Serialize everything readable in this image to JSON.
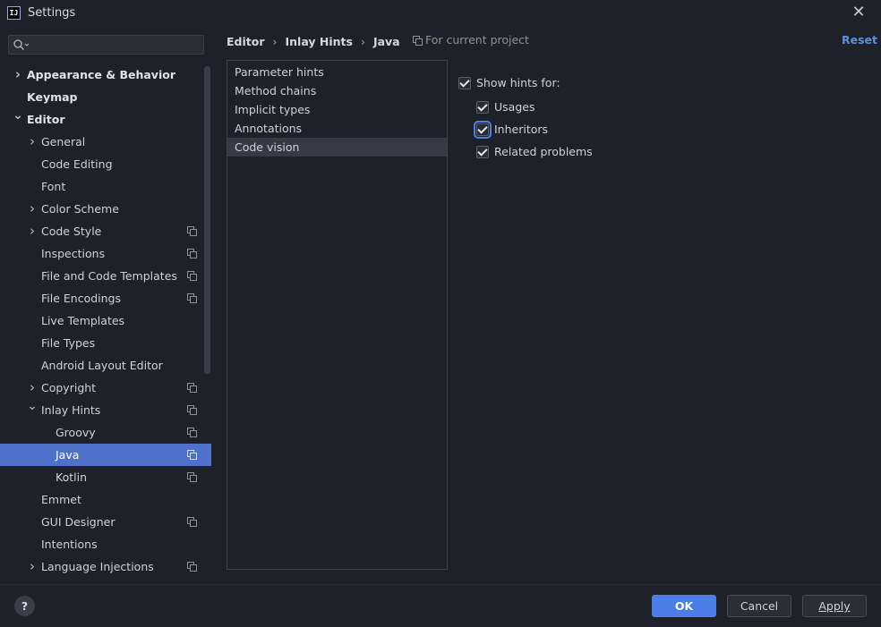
{
  "window": {
    "title": "Settings",
    "app_icon_text": "IJ"
  },
  "search": {
    "placeholder": ""
  },
  "tree": [
    {
      "label": "Appearance & Behavior",
      "level": 0,
      "bold": true,
      "expand": "collapsed",
      "copy": false,
      "selected": false
    },
    {
      "label": "Keymap",
      "level": 0,
      "bold": true,
      "expand": "none",
      "copy": false,
      "selected": false
    },
    {
      "label": "Editor",
      "level": 0,
      "bold": true,
      "expand": "expanded",
      "copy": false,
      "selected": false
    },
    {
      "label": "General",
      "level": 1,
      "bold": false,
      "expand": "collapsed",
      "copy": false,
      "selected": false
    },
    {
      "label": "Code Editing",
      "level": 1,
      "bold": false,
      "expand": "none",
      "copy": false,
      "selected": false
    },
    {
      "label": "Font",
      "level": 1,
      "bold": false,
      "expand": "none",
      "copy": false,
      "selected": false
    },
    {
      "label": "Color Scheme",
      "level": 1,
      "bold": false,
      "expand": "collapsed",
      "copy": false,
      "selected": false
    },
    {
      "label": "Code Style",
      "level": 1,
      "bold": false,
      "expand": "collapsed",
      "copy": true,
      "selected": false
    },
    {
      "label": "Inspections",
      "level": 1,
      "bold": false,
      "expand": "none",
      "copy": true,
      "selected": false
    },
    {
      "label": "File and Code Templates",
      "level": 1,
      "bold": false,
      "expand": "none",
      "copy": true,
      "selected": false
    },
    {
      "label": "File Encodings",
      "level": 1,
      "bold": false,
      "expand": "none",
      "copy": true,
      "selected": false
    },
    {
      "label": "Live Templates",
      "level": 1,
      "bold": false,
      "expand": "none",
      "copy": false,
      "selected": false
    },
    {
      "label": "File Types",
      "level": 1,
      "bold": false,
      "expand": "none",
      "copy": false,
      "selected": false
    },
    {
      "label": "Android Layout Editor",
      "level": 1,
      "bold": false,
      "expand": "none",
      "copy": false,
      "selected": false
    },
    {
      "label": "Copyright",
      "level": 1,
      "bold": false,
      "expand": "collapsed",
      "copy": true,
      "selected": false
    },
    {
      "label": "Inlay Hints",
      "level": 1,
      "bold": false,
      "expand": "expanded",
      "copy": true,
      "selected": false
    },
    {
      "label": "Groovy",
      "level": 2,
      "bold": false,
      "expand": "none",
      "copy": true,
      "selected": false
    },
    {
      "label": "Java",
      "level": 2,
      "bold": false,
      "expand": "none",
      "copy": true,
      "selected": true
    },
    {
      "label": "Kotlin",
      "level": 2,
      "bold": false,
      "expand": "none",
      "copy": true,
      "selected": false
    },
    {
      "label": "Emmet",
      "level": 1,
      "bold": false,
      "expand": "none",
      "copy": false,
      "selected": false
    },
    {
      "label": "GUI Designer",
      "level": 1,
      "bold": false,
      "expand": "none",
      "copy": true,
      "selected": false
    },
    {
      "label": "Intentions",
      "level": 1,
      "bold": false,
      "expand": "none",
      "copy": false,
      "selected": false
    },
    {
      "label": "Language Injections",
      "level": 1,
      "bold": false,
      "expand": "collapsed",
      "copy": true,
      "selected": false
    }
  ],
  "breadcrumb": {
    "items": [
      "Editor",
      "Inlay Hints",
      "Java"
    ],
    "sep": "›",
    "project_note": "For current project",
    "reset_label": "Reset"
  },
  "hint_list": {
    "items": [
      "Parameter hints",
      "Method chains",
      "Implicit types",
      "Annotations",
      "Code vision"
    ],
    "selected_index": 4
  },
  "options": {
    "show_hints": {
      "label": "Show hints for:",
      "checked": true
    },
    "children": [
      {
        "label": "Usages",
        "checked": true,
        "focused": false
      },
      {
        "label": "Inheritors",
        "checked": true,
        "focused": true
      },
      {
        "label": "Related problems",
        "checked": true,
        "focused": false
      }
    ]
  },
  "footer": {
    "help": "?",
    "ok": "OK",
    "cancel": "Cancel",
    "apply": "Apply"
  },
  "colors": {
    "background": "#1f2128",
    "selection": "#4f71c9",
    "accent": "#4b7ee8",
    "link": "#5a8fe6"
  }
}
